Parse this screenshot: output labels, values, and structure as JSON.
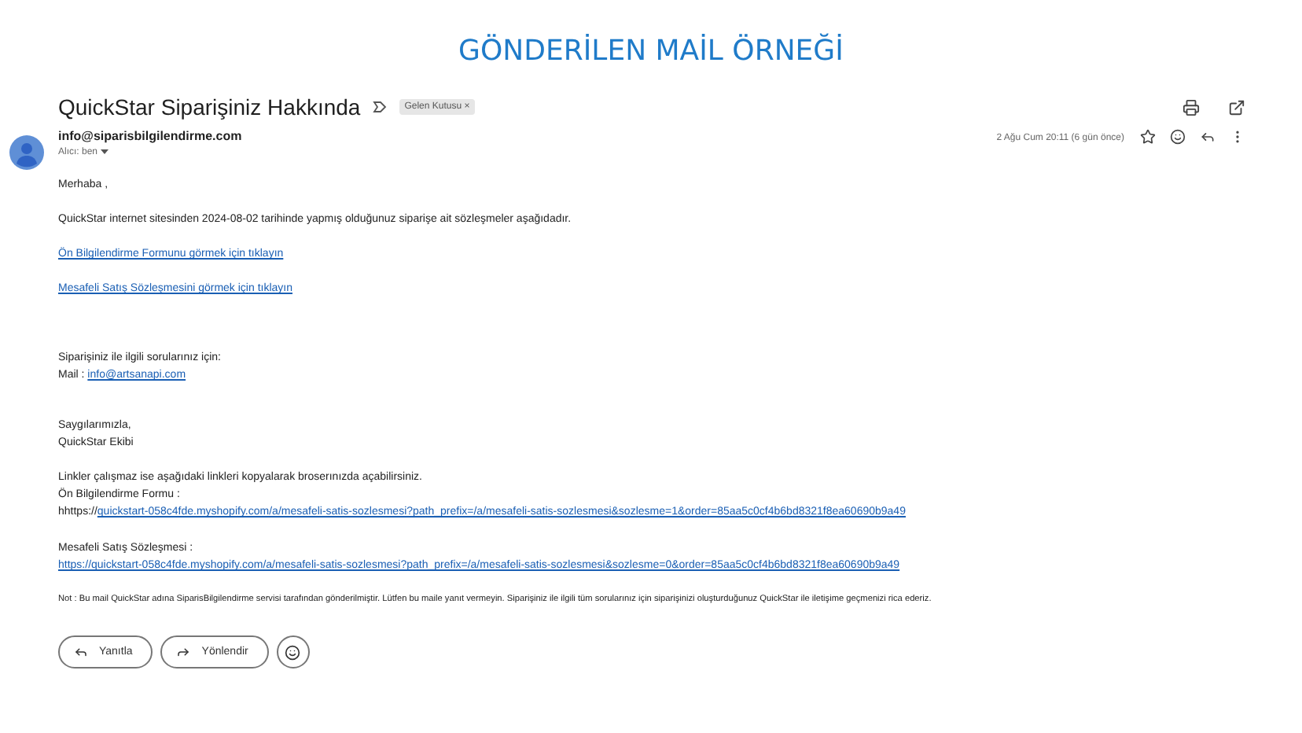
{
  "page_heading": "GÖNDERİLEN MAİL ÖRNEĞİ",
  "email": {
    "subject": "QuickStar Siparişiniz Hakkında",
    "label": {
      "text": "Gelen Kutusu",
      "remove": "×"
    },
    "sender": "info@siparisbilgilendirme.com",
    "recipient": "Alıcı: ben",
    "date": "2 Ağu Cum 20:11 (6 gün önce)",
    "starred": false,
    "body": [
      [
        [
          {
            "kind": "text",
            "text": "Merhaba ,"
          }
        ]
      ],
      [
        [
          {
            "kind": "text",
            "text": "QuickStar internet sitesinden 2024-08-02 tarihinde yapmış olduğunuz siparişe ait sözleşmeler aşağıdadır."
          }
        ]
      ],
      [
        [
          {
            "kind": "link",
            "text": "Ön Bilgilendirme Formunu görmek için tıklayın"
          }
        ]
      ],
      [
        [
          {
            "kind": "link",
            "text": "Mesafeli Satış Sözleşmesini görmek için tıklayın"
          }
        ]
      ],
      [
        [
          {
            "kind": "text",
            "text": "Siparişiniz ile ilgili sorularınız için:"
          }
        ],
        [
          {
            "kind": "text",
            "text": "Mail : "
          },
          {
            "kind": "link",
            "text": "info@artsanapi.com"
          }
        ]
      ],
      [
        [
          {
            "kind": "text",
            "text": "Saygılarımızla,"
          }
        ],
        [
          {
            "kind": "text",
            "text": "QuickStar Ekibi"
          }
        ]
      ],
      [
        [
          {
            "kind": "text",
            "text": "Linkler çalışmaz ise aşağıdaki linkleri kopyalarak broserınızda açabilirsiniz."
          }
        ],
        [
          {
            "kind": "text",
            "text": "Ön Bilgilendirme Formu :"
          }
        ],
        [
          {
            "kind": "text",
            "text": "hhttps://"
          },
          {
            "kind": "link",
            "text": "quickstart-058c4fde.myshopify.com/a/mesafeli-satis-sozlesmesi?path_prefix=/a/mesafeli-satis-sozlesmesi&sozlesme=1&order=85aa5c0cf4b6bd8321f8ea60690b9a49"
          }
        ]
      ],
      [
        [
          {
            "kind": "text",
            "text": "Mesafeli Satış Sözleşmesi :"
          }
        ],
        [
          {
            "kind": "link",
            "text": "https://quickstart-058c4fde.myshopify.com/a/mesafeli-satis-sozlesmesi?path_prefix=/a/mesafeli-satis-sozlesmesi&sozlesme=0&order=85aa5c0cf4b6bd8321f8ea60690b9a49"
          }
        ]
      ],
      [
        [
          {
            "kind": "note",
            "text": "Not : Bu mail QuickStar adına SiparisBilgilendirme servisi tarafından gönderilmiştir. Lütfen bu maile yanıt vermeyin. Siparişiniz ile ilgili tüm sorularınız için siparişinizi oluşturduğunuz QuickStar ile iletişime geçmenizi rica ederiz."
          }
        ]
      ]
    ],
    "actions": [
      "Yanıtla",
      "Yönlendir"
    ]
  }
}
